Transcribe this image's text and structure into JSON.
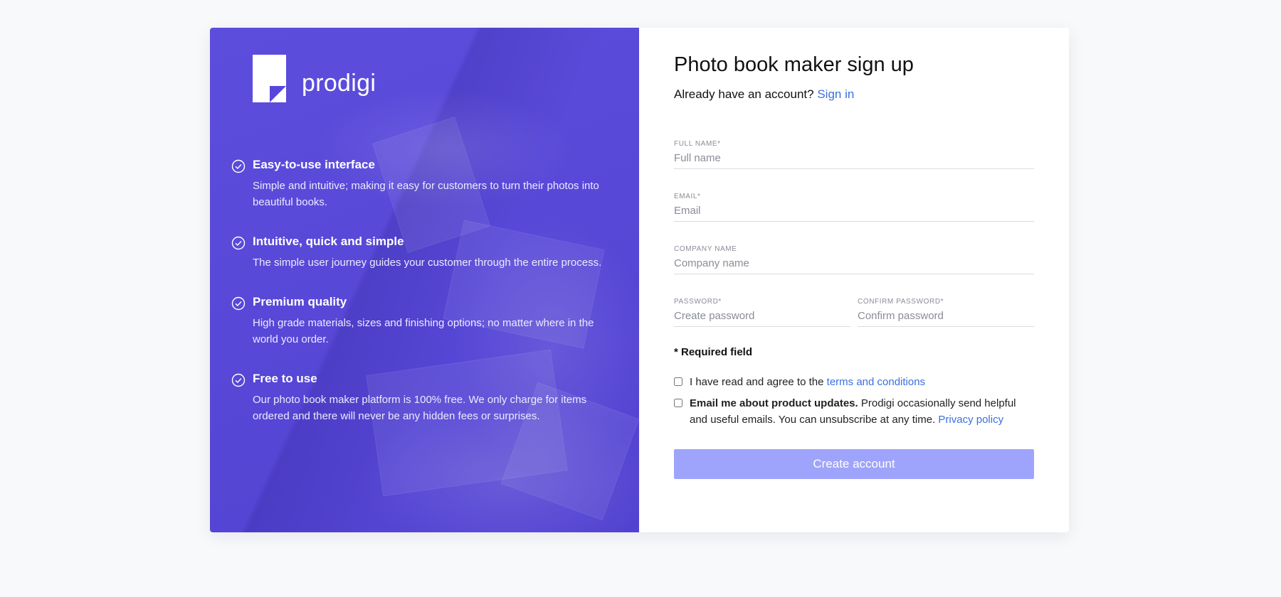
{
  "brand": {
    "name": "prodigi",
    "panel_color": "#5646dc"
  },
  "features": [
    {
      "title": "Easy-to-use interface",
      "text": "Simple and intuitive; making it easy for customers to turn their photos into beautiful books."
    },
    {
      "title": "Intuitive, quick and simple",
      "text": "The simple user journey guides your customer through the entire process."
    },
    {
      "title": "Premium quality",
      "text": "High grade materials, sizes and finishing options; no matter where in the world you order."
    },
    {
      "title": "Free to use",
      "text": "Our photo book maker platform is 100% free. We only charge for items ordered and there will never be any hidden fees or surprises."
    }
  ],
  "form": {
    "title": "Photo book maker sign up",
    "signin_prompt": "Already have an account?",
    "signin_link": "Sign in",
    "full_name": {
      "label": "FULL NAME*",
      "placeholder": "Full name"
    },
    "email": {
      "label": "EMAIL*",
      "placeholder": "Email"
    },
    "company": {
      "label": "COMPANY NAME",
      "placeholder": "Company name"
    },
    "password": {
      "label": "PASSWORD*",
      "placeholder": "Create password"
    },
    "confirm_password": {
      "label": "CONFIRM PASSWORD*",
      "placeholder": "Confirm password"
    },
    "required_note": "* Required field",
    "terms": {
      "prefix": "I have read and agree to the",
      "link": "terms and conditions"
    },
    "updates": {
      "bold": "Email me about product updates.",
      "text": "Prodigi occasionally send helpful and useful emails. You can unsubscribe at any time.",
      "link": "Privacy policy"
    },
    "submit_label": "Create account",
    "accent_color": "#3b6fe0",
    "button_color": "#9ea4fb"
  }
}
